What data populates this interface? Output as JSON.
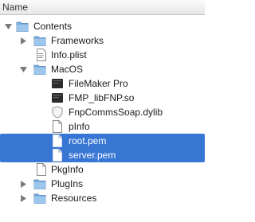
{
  "column_header": {
    "name_label": "Name"
  },
  "tree": {
    "contents": {
      "label": "Contents"
    },
    "frameworks": {
      "label": "Frameworks"
    },
    "info_plist": {
      "label": "Info.plist"
    },
    "macos": {
      "label": "MacOS"
    },
    "filemaker_pro": {
      "label": "FileMaker Pro"
    },
    "fmp_libfnp": {
      "label": "FMP_libFNP.so"
    },
    "fnpcommssoap": {
      "label": "FnpCommsSoap.dylib"
    },
    "pinfo": {
      "label": "pInfo"
    },
    "root_pem": {
      "label": "root.pem"
    },
    "server_pem": {
      "label": "server.pem"
    },
    "pkginfo": {
      "label": "PkgInfo"
    },
    "plugins": {
      "label": "PlugIns"
    },
    "resources": {
      "label": "Resources"
    }
  },
  "colors": {
    "selection": "#3876d4",
    "folder": "#7eb1e0"
  }
}
